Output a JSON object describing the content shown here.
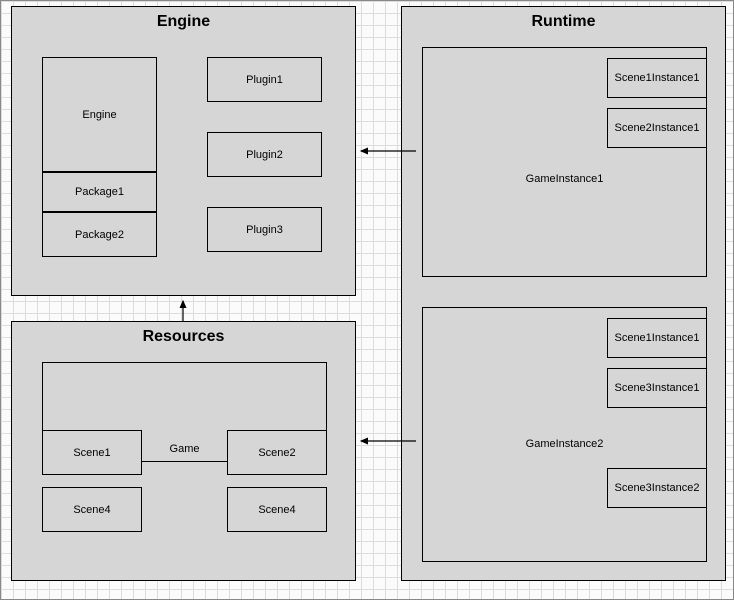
{
  "engine": {
    "title": "Engine",
    "engine_label": "Engine",
    "package1": "Package1",
    "package2": "Package2",
    "plugin1": "Plugin1",
    "plugin2": "Plugin2",
    "plugin3": "Plugin3"
  },
  "resources": {
    "title": "Resources",
    "game_label": "Game",
    "scene1": "Scene1",
    "scene2": "Scene2",
    "scene4a": "Scene4",
    "scene4b": "Scene4"
  },
  "runtime": {
    "title": "Runtime",
    "game_instance1": {
      "label": "GameInstance1",
      "scene1instance1": "Scene1Instance1",
      "scene2instance1": "Scene2Instance1"
    },
    "game_instance2": {
      "label": "GameInstance2",
      "scene1instance1": "Scene1Instance1",
      "scene3instance1": "Scene3Instance1",
      "scene3instance2": "Scene3Instance2"
    }
  }
}
